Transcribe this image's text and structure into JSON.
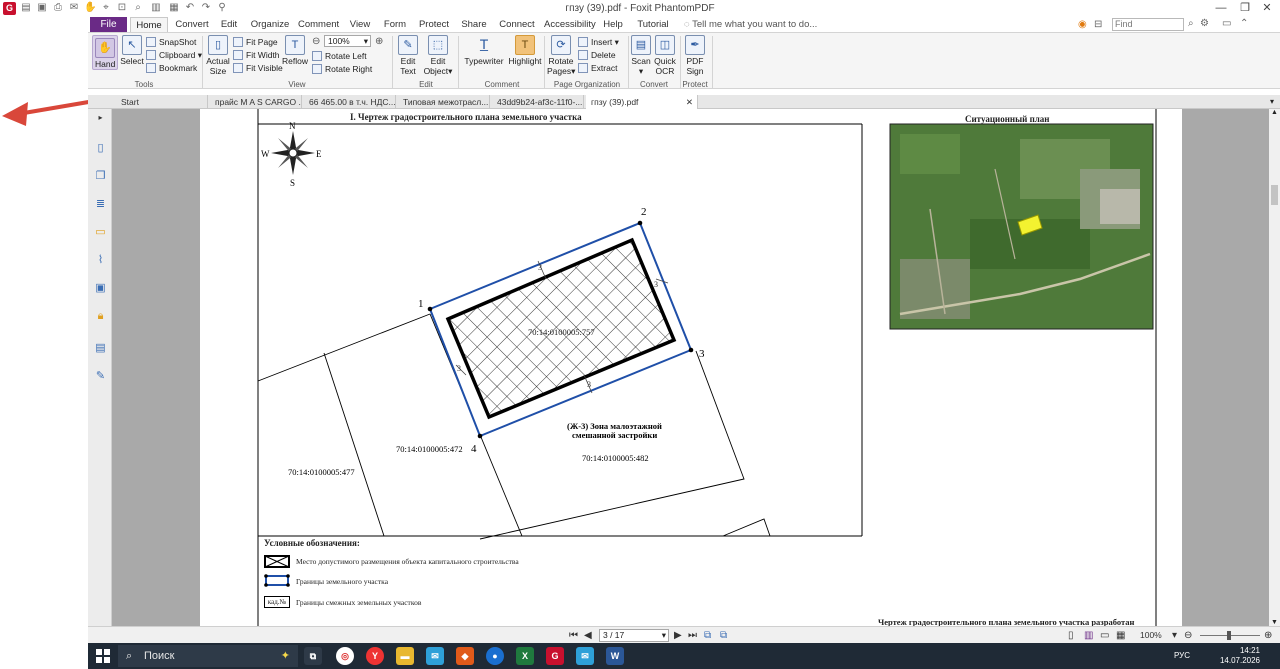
{
  "window": {
    "title": "гпзу (39).pdf - Foxit PhantomPDF",
    "logo_letter": "G",
    "controls": [
      "—",
      "❐",
      "✕"
    ]
  },
  "ribbon_tabs": [
    "File",
    "Home",
    "Convert",
    "Edit",
    "Organize",
    "Comment",
    "View",
    "Form",
    "Protect",
    "Share",
    "Connect",
    "Accessibility",
    "Help",
    "Tutorial"
  ],
  "active_tab": "Home",
  "tell_me_placeholder": "Tell me what you want to do...",
  "find_placeholder": "Find",
  "ribbon": {
    "tools": {
      "label": "Tools",
      "hand": "Hand",
      "select": "Select",
      "snapshot": "SnapShot",
      "clipboard": "Clipboard",
      "bookmark": "Bookmark"
    },
    "view": {
      "label": "View",
      "actual_size_1": "Actual",
      "actual_size_2": "Size",
      "fit_page": "Fit Page",
      "fit_width": "Fit Width",
      "fit_visible": "Fit Visible",
      "reflow": "Reflow",
      "zoom_value": "100%",
      "rotate_left": "Rotate Left",
      "rotate_right": "Rotate Right"
    },
    "edit": {
      "label": "Edit",
      "edit_text_1": "Edit",
      "edit_text_2": "Text",
      "edit_object_1": "Edit",
      "edit_object_2": "Object"
    },
    "comment": {
      "label": "Comment",
      "typewriter": "Typewriter",
      "highlight": "Highlight"
    },
    "page_org": {
      "label": "Page Organization",
      "rotate_pages_1": "Rotate",
      "rotate_pages_2": "Pages",
      "insert": "Insert",
      "delete": "Delete",
      "extract": "Extract"
    },
    "convert": {
      "label": "Convert",
      "scan": "Scan",
      "quick_ocr_1": "Quick",
      "quick_ocr_2": "OCR"
    },
    "protect": {
      "label": "Protect",
      "pdf_sign_1": "PDF",
      "pdf_sign_2": "Sign"
    }
  },
  "doc_tabs": [
    "Start",
    "прайс M A S CARGO ...",
    "66 465.00 в т.ч. НДС...",
    "Типовая межотрасл...",
    "43dd9b24-af3c-11f0-...",
    "гпзу (39).pdf"
  ],
  "active_doc_tab": "гпзу (39).pdf",
  "document": {
    "main_title": "I. Чертеж градостроительного плана земельного участка",
    "situational_title": "Ситуационный план",
    "compass": {
      "n": "N",
      "s": "S",
      "w": "W",
      "e": "E"
    },
    "corner_labels": [
      "1",
      "2",
      "3",
      "4"
    ],
    "dimension_labels": [
      "3",
      "3",
      "3",
      "3"
    ],
    "parcel_main": "70:14:0100005:757",
    "parcel_472": "70:14:0100005:472",
    "parcel_477": "70:14:0100005:477",
    "parcel_482": "70:14:0100005:482",
    "zone_label_1": "(Ж-3) Зона малоэтажной",
    "zone_label_2": "смешанной застройки",
    "legend_title": "Условные обозначения:",
    "legend_items": [
      "Место допустимого размещения объекта капитального строительства",
      "Границы земельного участка",
      "Границы смежных земельных участков"
    ],
    "legend_kad": "кад.№",
    "footer_text": "Чертеж градостроительного плана земельного участка разработан"
  },
  "statusbar": {
    "page_value": "3 / 17",
    "zoom": "100%"
  },
  "taskbar": {
    "search": "Поиск",
    "lang": "РУС",
    "time": "14:21",
    "date": "14.07.2026"
  },
  "colors": {
    "file_tab": "#6a2a86",
    "boundary_blue": "#1f4fa8",
    "taskbar": "#1f2a36",
    "arrow": "#d9473a",
    "satellite_green": "#4f7a3a"
  }
}
